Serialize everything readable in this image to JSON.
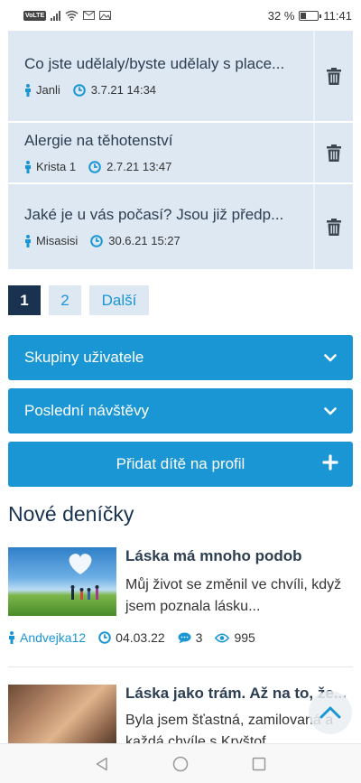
{
  "status_bar": {
    "carrier_badge": "VoLTE",
    "battery_percent": "32 %",
    "time": "11:41"
  },
  "threads": [
    {
      "title": "Co jste udělaly/byste udělaly s place...",
      "author": "Janli",
      "date": "3.7.21 14:34"
    },
    {
      "title": "Alergie na těhotenství",
      "author": "Krista 1",
      "date": "2.7.21 13:47"
    },
    {
      "title": "Jaké je u vás počasí? Jsou již předp...",
      "author": "Misasisi",
      "date": "30.6.21 15:27"
    }
  ],
  "pagination": {
    "current": "1",
    "page2": "2",
    "next": "Další"
  },
  "accordions": {
    "groups": "Skupiny uživatele",
    "visits": "Poslední návštěvy",
    "add_child": "Přidat dítě na profil"
  },
  "diaries_section": {
    "title": "Nové deníčky",
    "items": [
      {
        "title": "Láska má mnoho podob",
        "excerpt": "Můj život se změnil ve chvíli, když jsem poznala lásku...",
        "author": "Andvejka12",
        "date": "04.03.22",
        "comments": "3",
        "views": "995"
      },
      {
        "title": "Láska jako trám. Až na to, že...",
        "excerpt": "Byla jsem šťastná, zamilovaná a každá chvíle s Kryštof..."
      }
    ]
  },
  "colors": {
    "accent": "#1a96d4",
    "navy": "#18324f",
    "card_bg": "#dde8f3"
  }
}
